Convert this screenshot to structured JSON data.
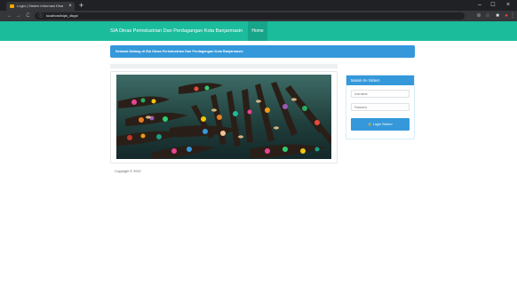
{
  "browser": {
    "tab_title": "Login | Sistem Informasi Dinas P...",
    "tab_close": "×",
    "new_tab": "+",
    "url": "localhost/sipk_dkpp/",
    "window_controls": {
      "minimize": "–",
      "maximize": "☐",
      "close": "×"
    },
    "nav": {
      "back": "←",
      "forward": "→",
      "reload": "C"
    },
    "icons": [
      "info-icon",
      "star-icon",
      "extension-icon",
      "profile-icon",
      "menu-icon"
    ]
  },
  "navbar": {
    "brand": "SIA Dinas Perindustrian Dan Perdagangan Kota Banjarmasin",
    "home": "Home",
    "color": "#1abc9c"
  },
  "welcome": {
    "text": "Selamat Datang di SIA Dinas Perindustrian Dan Perdagangan Kota Banjarmasin",
    "color": "#3498db"
  },
  "login": {
    "heading": "Masuk Ke Sistem",
    "username_placeholder": "Username",
    "password_placeholder": "Password",
    "button": "Login Sistem",
    "button_icon": "lock-icon"
  },
  "footer": {
    "copyright": "Copyright © 2022"
  }
}
